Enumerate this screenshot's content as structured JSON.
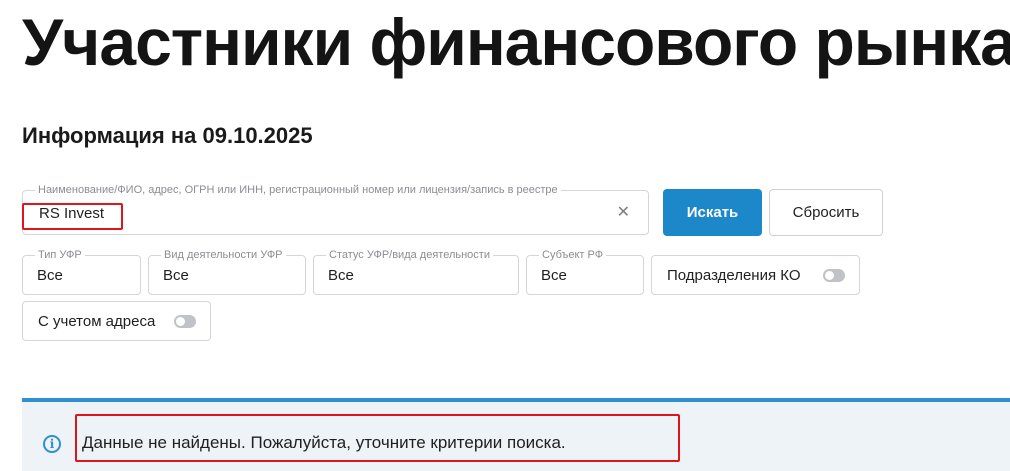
{
  "page": {
    "title": "Участники финансового рынка",
    "info_date": "Информация на 09.10.2025"
  },
  "search": {
    "legend": "Наименование/ФИО, адрес, ОГРН или ИНН, регистрационный номер или лицензия/запись в реестре",
    "value": "RS Invest",
    "clear_icon": "close-icon"
  },
  "buttons": {
    "search_label": "Искать",
    "reset_label": "Сбросить"
  },
  "filters": [
    {
      "legend": "Тип УФР",
      "value": "Все"
    },
    {
      "legend": "Вид деятельности УФР",
      "value": "Все"
    },
    {
      "legend": "Статус УФР/вида деятельности",
      "value": "Все"
    },
    {
      "legend": "Субъект РФ",
      "value": "Все"
    }
  ],
  "toggles": {
    "ko_divisions": {
      "label": "Подразделения КО",
      "on": false
    },
    "with_address": {
      "label": "С учетом адреса",
      "on": false
    }
  },
  "message": {
    "icon": "info-icon",
    "text": "Данные не найдены. Пожалуйста, уточните критерии поиска."
  },
  "colors": {
    "accent": "#1c87c9",
    "highlight": "#e0151c",
    "message_bg": "#eef3f7"
  }
}
